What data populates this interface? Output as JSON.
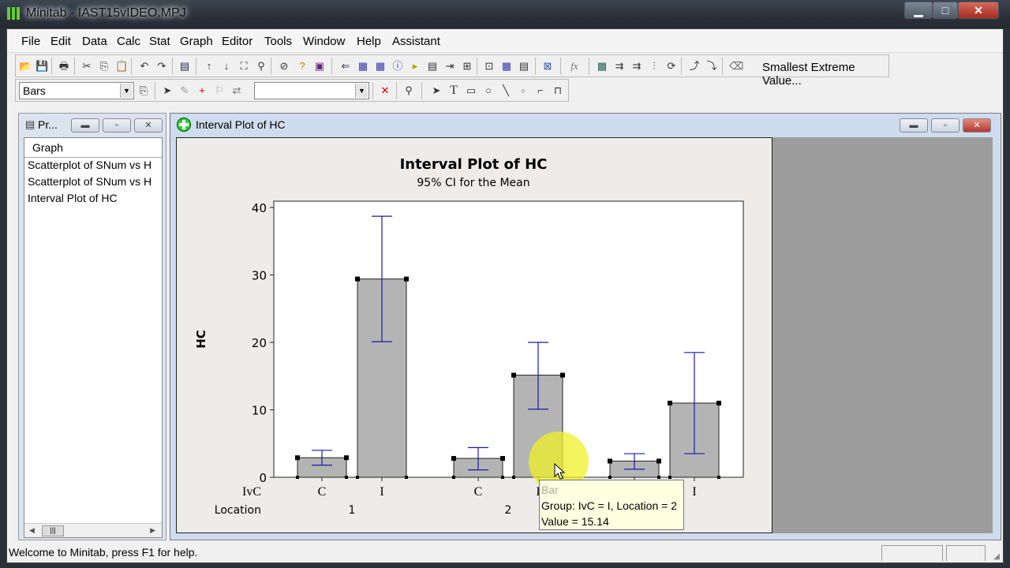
{
  "app": {
    "title": "Minitab - IAST15vIDEO.MPJ",
    "window_buttons": {
      "minimize": "▁",
      "maximize": "□",
      "close": "✕"
    }
  },
  "menubar": [
    {
      "label": "File"
    },
    {
      "label": "Edit"
    },
    {
      "label": "Data"
    },
    {
      "label": "Calc"
    },
    {
      "label": "Stat"
    },
    {
      "label": "Graph"
    },
    {
      "label": "Editor"
    },
    {
      "label": "Tools"
    },
    {
      "label": "Window"
    },
    {
      "label": "Help"
    },
    {
      "label": "Assistant"
    }
  ],
  "toolbar": {
    "smallest_extreme": "Smallest Extreme Value...",
    "graph_element_select": "Bars",
    "second_select": ""
  },
  "project_manager": {
    "title": "Pr...",
    "header": "Graph",
    "items": [
      "Scatterplot of SNum vs H",
      "Scatterplot of SNum vs H",
      "Interval Plot of HC"
    ]
  },
  "graph_window": {
    "title": "Interval Plot of HC"
  },
  "tooltip": {
    "line1": "Bar",
    "line2": "Group: IvC = I, Location = 2",
    "line3": "Value = 15.14"
  },
  "status": {
    "text": "Welcome to Minitab, press F1 for help."
  },
  "chart_data": {
    "type": "bar",
    "title": "Interval Plot of HC",
    "subtitle": "95% CI for the Mean",
    "ylabel": "HC",
    "xlabel_rows": [
      "IvC",
      "Location"
    ],
    "ylim": [
      0,
      40
    ],
    "yticks": [
      0,
      10,
      20,
      30,
      40
    ],
    "groups": [
      {
        "location": "1",
        "bars": [
          {
            "ivc": "C",
            "mean": 2.9,
            "ci_low": 1.8,
            "ci_high": 4.0
          },
          {
            "ivc": "I",
            "mean": 29.4,
            "ci_low": 20.1,
            "ci_high": 38.7
          }
        ]
      },
      {
        "location": "2",
        "bars": [
          {
            "ivc": "C",
            "mean": 2.8,
            "ci_low": 1.1,
            "ci_high": 4.4
          },
          {
            "ivc": "I",
            "mean": 15.14,
            "ci_low": 10.1,
            "ci_high": 20.0
          }
        ]
      },
      {
        "location": "",
        "bars": [
          {
            "ivc": "",
            "mean": 2.4,
            "ci_low": 1.2,
            "ci_high": 3.5
          },
          {
            "ivc": "I",
            "mean": 11.0,
            "ci_low": 3.5,
            "ci_high": 18.5
          }
        ]
      }
    ],
    "colors": {
      "bar_fill": "#b4b4b4",
      "ci_line": "#1a1aa8",
      "selection_handle": "#000000"
    },
    "grid": false
  }
}
